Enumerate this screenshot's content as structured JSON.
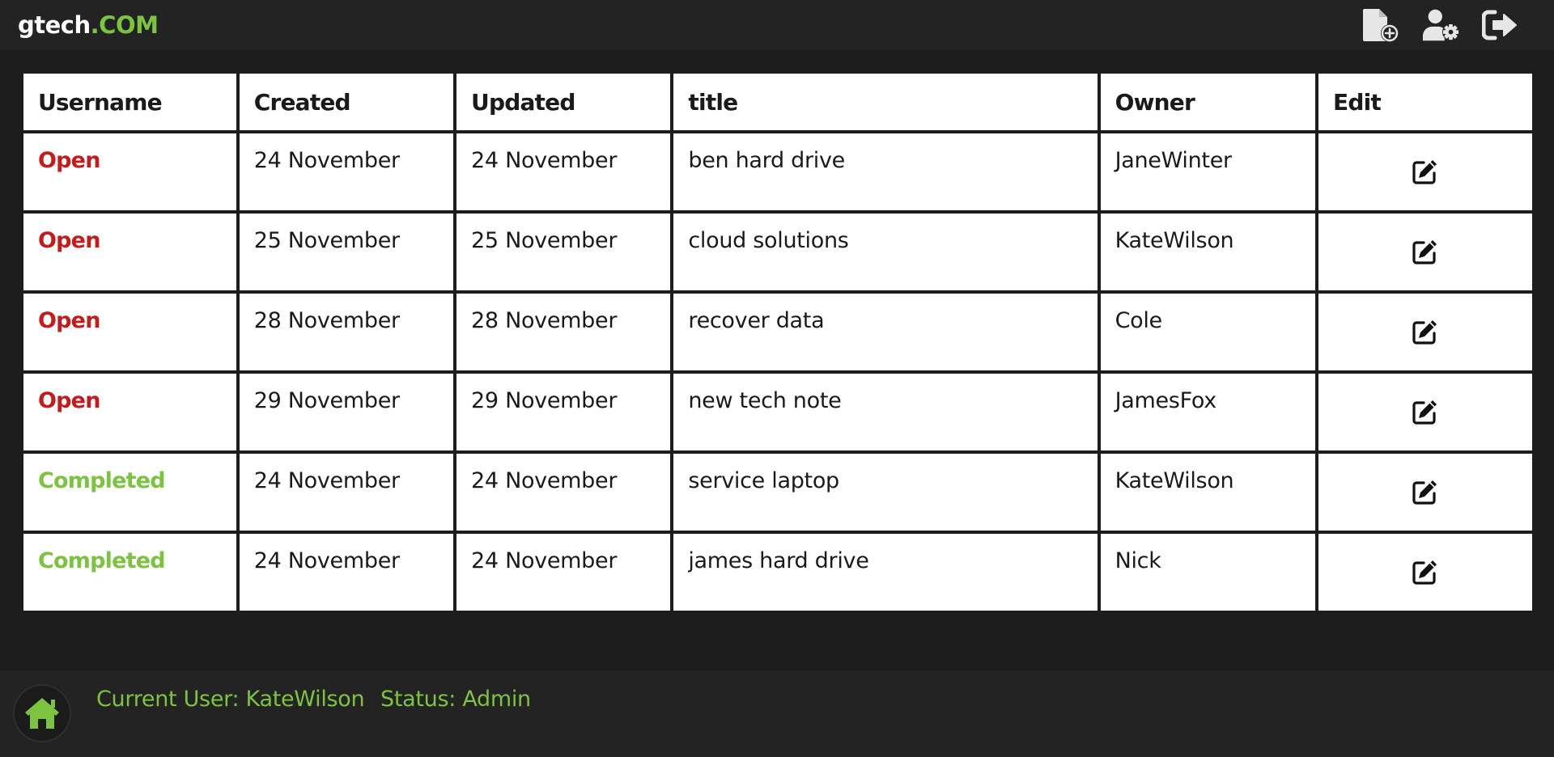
{
  "brand": {
    "name_main": "gtech",
    "name_suffix": ".COM",
    "accent_color": "#7cc33f"
  },
  "header_actions": [
    {
      "icon": "file-plus-icon"
    },
    {
      "icon": "user-gear-icon"
    },
    {
      "icon": "sign-out-icon"
    }
  ],
  "table": {
    "columns": [
      "Username",
      "Created",
      "Updated",
      "title",
      "Owner",
      "Edit"
    ],
    "rows": [
      {
        "status": "Open",
        "created": "24 November",
        "updated": "24 November",
        "title": "ben hard drive",
        "owner": "JaneWinter"
      },
      {
        "status": "Open",
        "created": "25 November",
        "updated": "25 November",
        "title": "cloud solutions",
        "owner": "KateWilson"
      },
      {
        "status": "Open",
        "created": "28 November",
        "updated": "28 November",
        "title": "recover data",
        "owner": "Cole"
      },
      {
        "status": "Open",
        "created": "29 November",
        "updated": "29 November",
        "title": "new tech note",
        "owner": "JamesFox"
      },
      {
        "status": "Completed",
        "created": "24 November",
        "updated": "24 November",
        "title": "service laptop",
        "owner": "KateWilson"
      },
      {
        "status": "Completed",
        "created": "24 November",
        "updated": "24 November",
        "title": "james hard drive",
        "owner": "Nick"
      }
    ],
    "status_colors": {
      "Open": "#c41c1c",
      "Completed": "#7cc33f"
    },
    "edit_icon": "edit-icon"
  },
  "footer": {
    "home_icon": "home-icon",
    "current_user": "Current User: KateWilson",
    "status": "Status: Admin"
  }
}
